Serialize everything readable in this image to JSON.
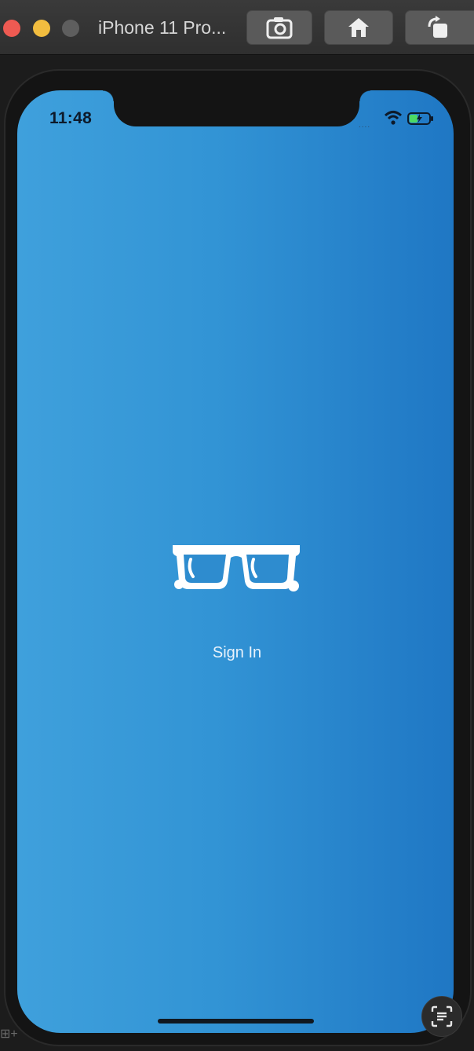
{
  "simulator": {
    "title": "iPhone 11 Pro...",
    "buttons": [
      {
        "icon": "camera-icon"
      },
      {
        "icon": "home-icon"
      },
      {
        "icon": "rotate-icon"
      }
    ]
  },
  "status_bar": {
    "time": "11:48",
    "signal": "....",
    "icons": [
      "wifi-icon",
      "battery-charging-icon"
    ]
  },
  "app": {
    "logo_icon": "glasses-icon",
    "sign_in_label": "Sign In",
    "colors": {
      "gradient_start": "#3fa0dc",
      "gradient_end": "#1f77c4",
      "text": "#e8f2fb"
    }
  },
  "overlay": {
    "scan_icon": "text-scan-icon",
    "corner_text": "⊞+"
  }
}
